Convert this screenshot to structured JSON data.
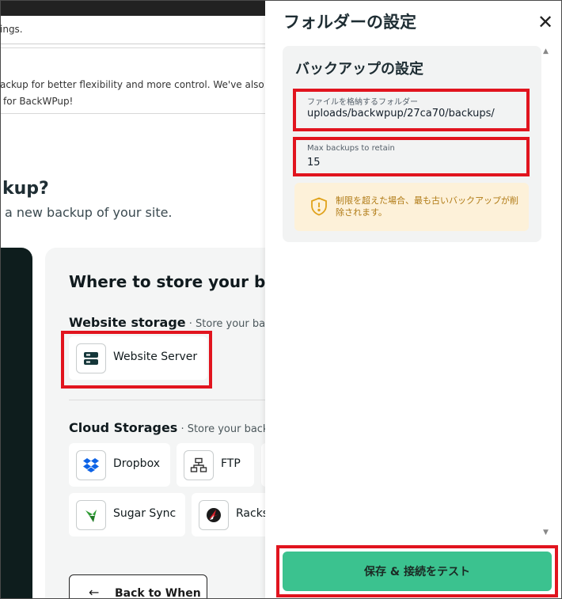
{
  "background": {
    "notice1_text": "ings.",
    "notice2_line1": "ackup for better flexibility and more control. We've also added",
    "notice2_line2": "for BackWPup!",
    "heading": "kup?",
    "subheading": "a new backup of your site.",
    "store_title": "Where to store your ba",
    "website_storage": {
      "title": "Website storage",
      "subtitle": " · Store your back",
      "tile": {
        "label": "Website Server",
        "icon": "server-icon"
      }
    },
    "cloud_storages": {
      "title": "Cloud Storages",
      "subtitle": " · Store your backu",
      "tiles": [
        {
          "label": "Dropbox",
          "icon": "dropbox-icon"
        },
        {
          "label": "FTP",
          "icon": "ftp-network-icon"
        },
        {
          "label": "Sugar Sync",
          "icon": "sugarsync-icon"
        },
        {
          "label": "Racks",
          "icon": "rackspace-icon"
        }
      ]
    },
    "back_button": {
      "label": "Back to When",
      "icon": "arrow-left-icon"
    }
  },
  "drawer": {
    "title": "フォルダーの設定",
    "close_icon": "close-icon",
    "card_title": "バックアップの設定",
    "folder_field": {
      "label": "ファイルを格納するフォルダー",
      "value": "uploads/backwpup/27ca70/backups/"
    },
    "max_backups_field": {
      "label": "Max backups to retain",
      "value": "15"
    },
    "warning": {
      "icon": "shield-alert-icon",
      "text": "制限を超えた場合、最も古いバックアップが削除されます。"
    },
    "save_button": "保存 & 接続をテスト"
  },
  "colors": {
    "accent_green": "#3bc28f",
    "highlight_red": "#e1141e",
    "warning_bg": "#fdf1d9",
    "warning_text": "#b07a14",
    "dark_card": "#0e1d1d"
  }
}
